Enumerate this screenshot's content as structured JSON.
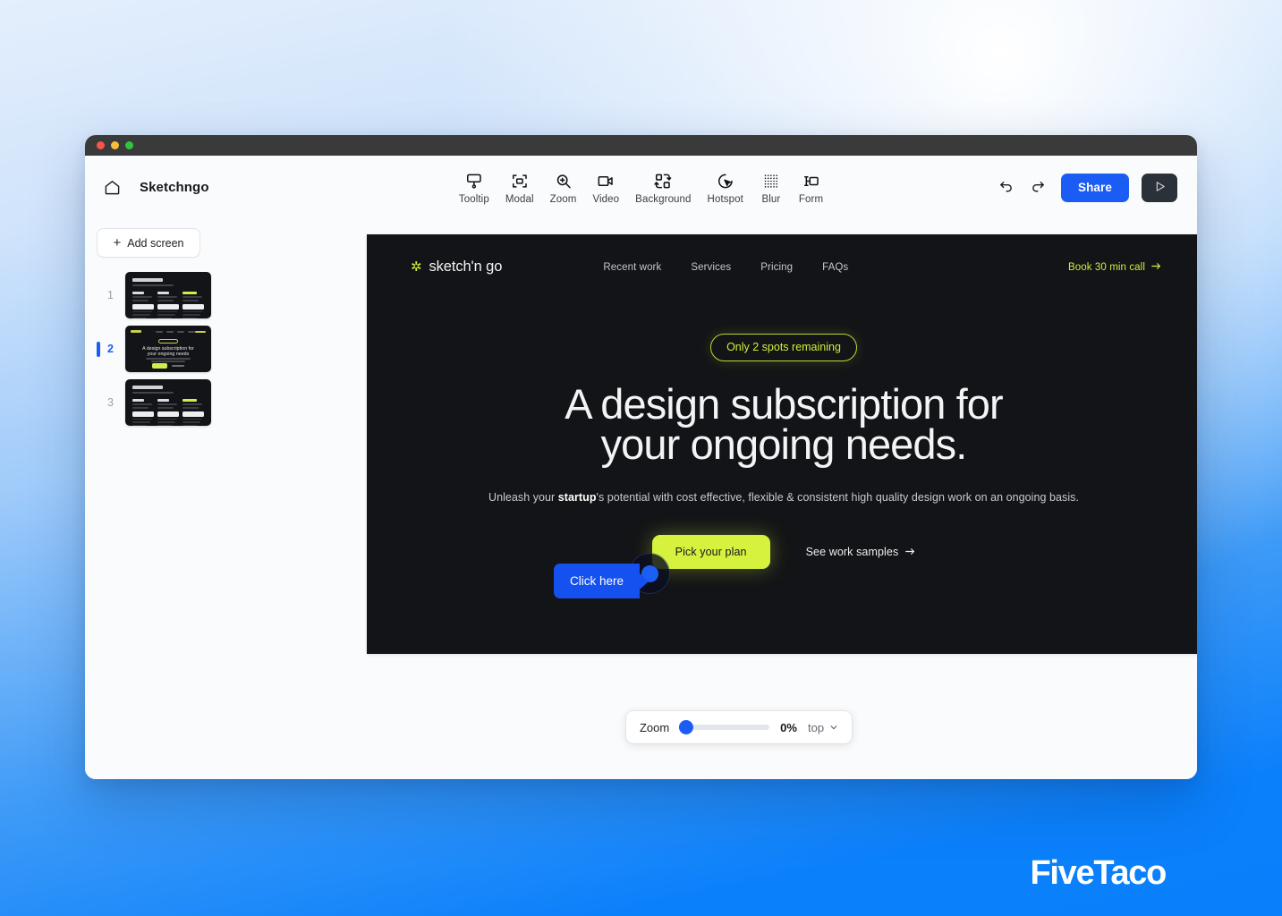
{
  "window": {
    "traffic_lights": [
      "close",
      "minimize",
      "maximize"
    ]
  },
  "header": {
    "home_icon": "home-icon",
    "brand": "Sketchngo",
    "tools": [
      {
        "icon": "tooltip-icon",
        "label": "Tooltip"
      },
      {
        "icon": "modal-icon",
        "label": "Modal"
      },
      {
        "icon": "zoom-icon",
        "label": "Zoom"
      },
      {
        "icon": "video-icon",
        "label": "Video"
      },
      {
        "icon": "background-icon",
        "label": "Background"
      },
      {
        "icon": "hotspot-icon",
        "label": "Hotspot"
      },
      {
        "icon": "blur-icon",
        "label": "Blur"
      },
      {
        "icon": "form-icon",
        "label": "Form"
      }
    ],
    "undo_icon": "undo-icon",
    "redo_icon": "redo-icon",
    "share_label": "Share",
    "play_icon": "play-icon",
    "accent_color": "#1b5cf5"
  },
  "sidebar": {
    "add_screen_label": "Add screen",
    "add_icon": "plus-icon",
    "screens": [
      {
        "number": "1",
        "kind": "plans",
        "selected": false
      },
      {
        "number": "2",
        "kind": "hero",
        "selected": true
      },
      {
        "number": "3",
        "kind": "plans",
        "selected": false
      }
    ],
    "thumb_titles": {
      "plans": "Membership plans",
      "hero": "A design subscription for your ongoing needs"
    }
  },
  "preview": {
    "site": {
      "logo": "sketch'n go",
      "logo_icon": "asterisk-icon",
      "nav_links": [
        "Recent work",
        "Services",
        "Pricing",
        "FAQs"
      ],
      "book_call": "Book 30 min call",
      "book_call_arrow": "arrow-right-icon",
      "pill": "Only 2 spots remaining",
      "headline_line1": "A design subscription for",
      "headline_line2": "your ongoing needs.",
      "subtext_before": "Unleash your ",
      "subtext_bold": "startup",
      "subtext_after": "'s potential with cost effective, flexible & consistent high quality design work on an ongoing basis.",
      "cta_primary": "Pick your plan",
      "cta_secondary": "See work samples",
      "cta_secondary_arrow": "arrow-right-icon",
      "accent_color": "#d7f13f",
      "bg_color": "#131417"
    },
    "overlay": {
      "tooltip_text": "Click here",
      "tooltip_color": "#1551ef",
      "hotspot_icon": "hotspot-dot-icon"
    },
    "scrollbar": {
      "up_arrow": "chevron-up-icon",
      "down_arrow": "chevron-down-icon"
    }
  },
  "zoombar": {
    "label": "Zoom",
    "value": "0%",
    "position": "top",
    "chevron": "chevron-down-icon"
  },
  "watermark": {
    "text": "FiveTaco"
  }
}
